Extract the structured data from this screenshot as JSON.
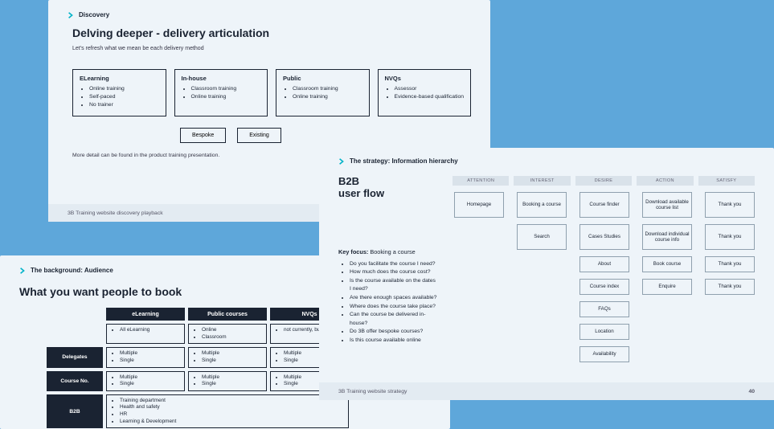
{
  "discovery": {
    "breadcrumb": "Discovery",
    "title": "Delving deeper - delivery articulation",
    "subtitle": "Let's refresh what we mean be each delivery method",
    "cards": [
      {
        "title": "ELearning",
        "items": [
          "Online training",
          "Self-paced",
          "No trainer"
        ]
      },
      {
        "title": "In-house",
        "items": [
          "Classroom training",
          "Online training"
        ]
      },
      {
        "title": "Public",
        "items": [
          "Classroom training",
          "Online training"
        ]
      },
      {
        "title": "NVQs",
        "items": [
          "Assessor",
          "Evidence-based qualification"
        ]
      }
    ],
    "buttons": [
      "Bespoke",
      "Existing"
    ],
    "more": "More detail can be found in the product training presentation.",
    "footer": "3B Training website discovery playback"
  },
  "background": {
    "breadcrumb": "The background: Audience",
    "title": "What you want people to book",
    "col_headers": [
      "eLearning",
      "Public courses",
      "NVQs"
    ],
    "rows": [
      {
        "label": "",
        "cells": [
          {
            "items": [
              "All eLearning"
            ]
          },
          {
            "items": [
              "Online",
              "Classroom"
            ]
          },
          {
            "items": [
              "not currently, but i"
            ]
          }
        ]
      },
      {
        "label": "Delegates",
        "cells": [
          {
            "items": [
              "Multiple",
              "Single"
            ]
          },
          {
            "items": [
              "Multiple",
              "Single"
            ]
          },
          {
            "items": [
              "Multiple",
              "Single"
            ]
          }
        ]
      },
      {
        "label": "Course No.",
        "cells": [
          {
            "items": [
              "Multiple",
              "Single"
            ]
          },
          {
            "items": [
              "Multiple",
              "Single"
            ]
          },
          {
            "items": [
              "Multiple",
              "Single"
            ]
          }
        ]
      },
      {
        "label": "B2B",
        "cells": [
          {
            "items": [
              "Training department",
              "Health and safety",
              "HR",
              "Learning & Development"
            ]
          },
          {
            "items": []
          },
          {
            "items": []
          }
        ]
      }
    ]
  },
  "strategy": {
    "breadcrumb": "The strategy: Information hierarchy",
    "heading_a": "B2B",
    "heading_b": "user flow",
    "key_focus_label": "Key focus:",
    "key_focus_value": "Booking a course",
    "questions": [
      "Do you facilitate the course I need?",
      "How much does the course cost?",
      "Is the course available on the dates I need?",
      "Are there enough spaces available?",
      "Where does the course take place?",
      "Can the course be delivered in-house?",
      "Do 3B offer bespoke courses?",
      "Is this course available online"
    ],
    "stages": [
      "ATTENTION",
      "INTEREST",
      "DESIRE",
      "ACTION",
      "SATISFY"
    ],
    "nodes": {
      "r1": [
        "Homepage",
        "Booking a course",
        "Course finder",
        "Download available course list",
        "Thank you"
      ],
      "r2": [
        "",
        "Search",
        "Cases Studies",
        "Download individual course info",
        "Thank you"
      ],
      "r3": [
        "",
        "",
        "About",
        "Book course",
        "Thank you"
      ],
      "r4": [
        "",
        "",
        "Course index",
        "Enquire",
        "Thank you"
      ],
      "r5": [
        "",
        "",
        "FAQs",
        "",
        ""
      ],
      "r6": [
        "",
        "",
        "Location",
        "",
        ""
      ],
      "r7": [
        "",
        "",
        "Availability",
        "",
        ""
      ]
    },
    "footer": "3B Training website strategy",
    "page": "40"
  }
}
